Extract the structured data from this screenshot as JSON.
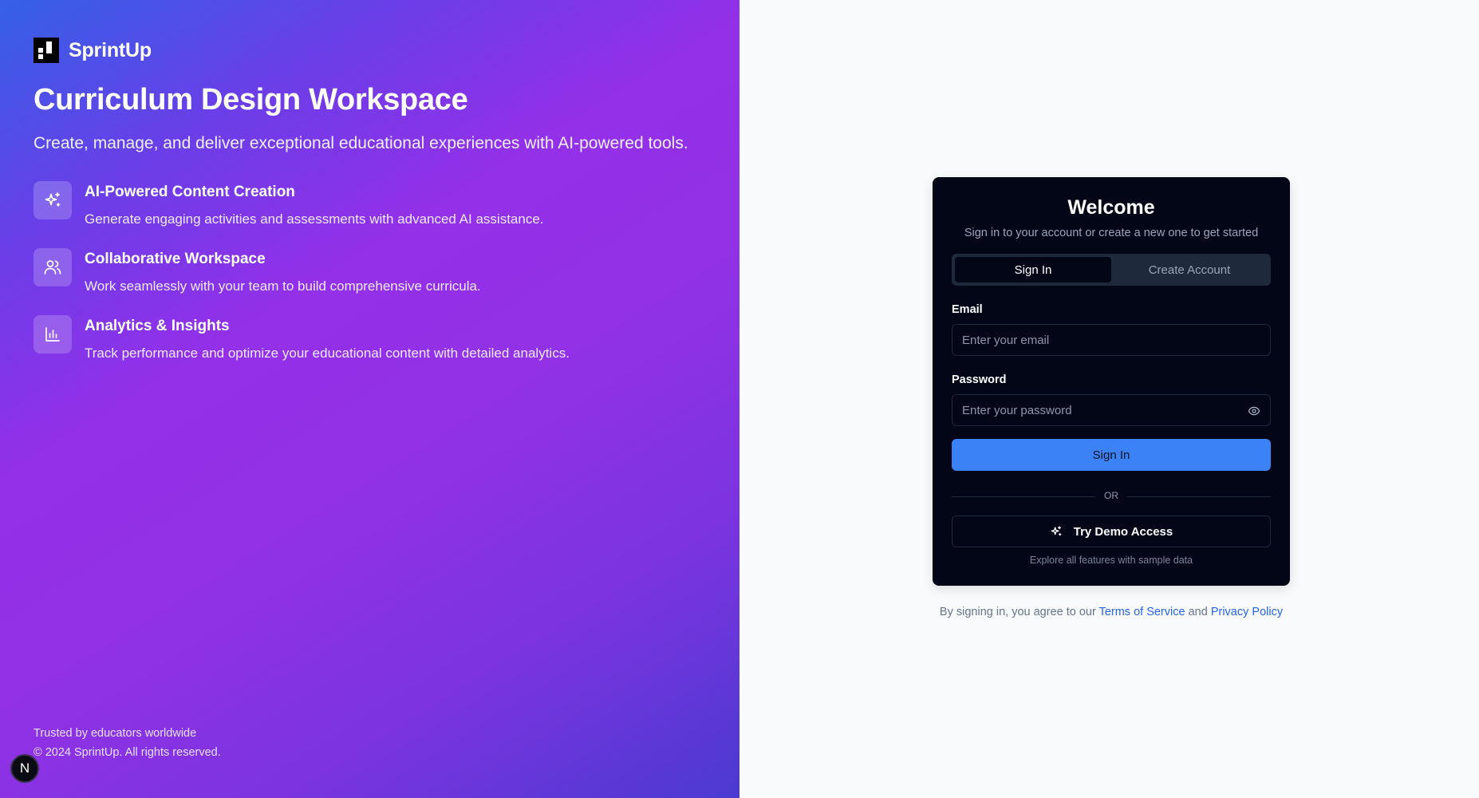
{
  "brand": {
    "name": "SprintUp"
  },
  "hero": {
    "title": "Curriculum Design Workspace",
    "subtitle": "Create, manage, and deliver exceptional educational experiences with AI-powered tools."
  },
  "features": [
    {
      "icon": "sparkles-icon",
      "title": "AI-Powered Content Creation",
      "description": "Generate engaging activities and assessments with advanced AI assistance."
    },
    {
      "icon": "users-icon",
      "title": "Collaborative Workspace",
      "description": "Work seamlessly with your team to build comprehensive curricula."
    },
    {
      "icon": "bar-chart-icon",
      "title": "Analytics & Insights",
      "description": "Track performance and optimize your educational content with detailed analytics."
    }
  ],
  "footer": {
    "trusted": "Trusted by educators worldwide",
    "copyright": "© 2024 SprintUp. All rights reserved."
  },
  "dev_badge": {
    "letter": "N"
  },
  "auth": {
    "title": "Welcome",
    "subtitle": "Sign in to your account or create a new one to get started",
    "tabs": [
      {
        "label": "Sign In",
        "active": true
      },
      {
        "label": "Create Account",
        "active": false
      }
    ],
    "email": {
      "label": "Email",
      "placeholder": "Enter your email",
      "value": ""
    },
    "password": {
      "label": "Password",
      "placeholder": "Enter your password",
      "value": ""
    },
    "submit_label": "Sign In",
    "divider_label": "OR",
    "demo_label": "Try Demo Access",
    "demo_hint": "Explore all features with sample data"
  },
  "terms": {
    "prefix": "By signing in, you agree to our",
    "tos_link": "Terms of Service",
    "conjunction": "and",
    "privacy_link": "Privacy Policy"
  },
  "colors": {
    "gradient_start": "#3461e7",
    "gradient_mid": "#9330e8",
    "gradient_end": "#4b3ad1",
    "card_bg": "#020617",
    "primary": "#3b82f6",
    "link": "#2563eb",
    "page_bg": "#f8fafc"
  }
}
